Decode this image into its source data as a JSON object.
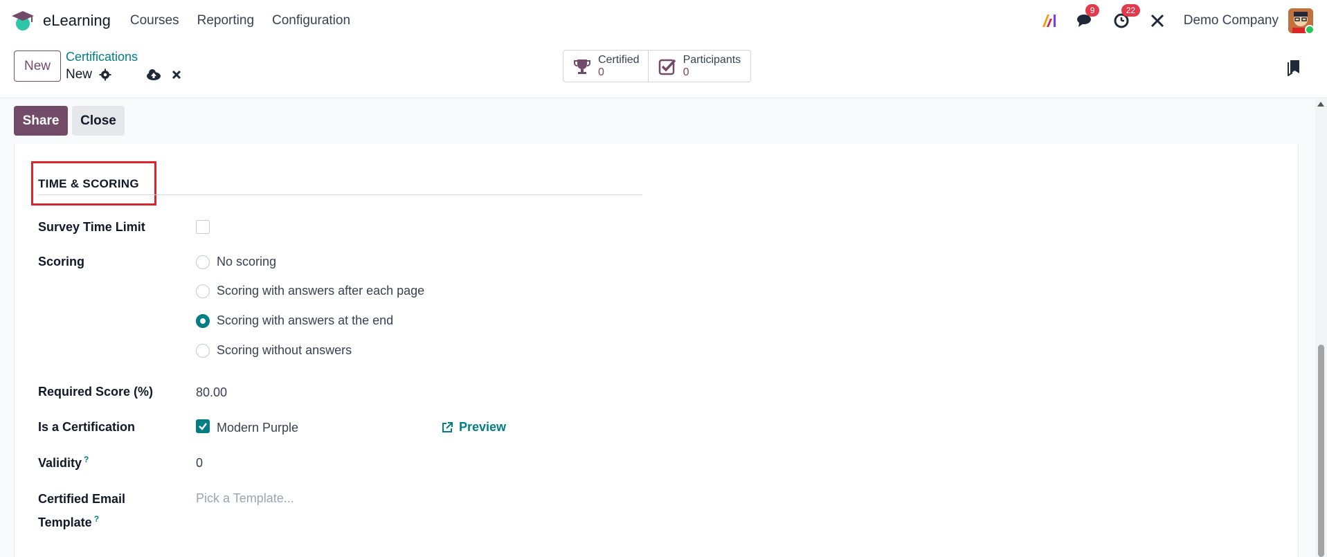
{
  "app": {
    "name": "eLearning",
    "menu": [
      "Courses",
      "Reporting",
      "Configuration"
    ],
    "company": "Demo Company",
    "badges": {
      "messages": "9",
      "activities": "22"
    }
  },
  "control_panel": {
    "new_label": "New",
    "breadcrumb_parent": "Certifications",
    "breadcrumb_current": "New",
    "stats": [
      {
        "label": "Certified",
        "value": "0"
      },
      {
        "label": "Participants",
        "value": "0"
      }
    ]
  },
  "status_bar": {
    "share_label": "Share",
    "close_label": "Close"
  },
  "form": {
    "section_title": "TIME & SCORING",
    "survey_time_limit": {
      "label": "Survey Time Limit",
      "checked": false
    },
    "scoring": {
      "label": "Scoring",
      "options": [
        {
          "label": "No scoring",
          "checked": false
        },
        {
          "label": "Scoring with answers after each page",
          "checked": false
        },
        {
          "label": "Scoring with answers at the end",
          "checked": true
        },
        {
          "label": "Scoring without answers",
          "checked": false
        }
      ]
    },
    "required_score": {
      "label": "Required Score (%)",
      "value": "80.00"
    },
    "is_certification": {
      "label": "Is a Certification",
      "checked": true,
      "layout_value": "Modern Purple",
      "preview_label": "Preview"
    },
    "validity": {
      "label": "Validity",
      "help": "?",
      "value": "0"
    },
    "certified_email_template": {
      "label_line1": "Certified Email",
      "label_line2": "Template",
      "help": "?",
      "placeholder": "Pick a Template..."
    }
  },
  "colors": {
    "primary": "#714b67",
    "accent": "#017e84",
    "highlight": "#d9232d",
    "badge": "#e03a4c"
  },
  "icons": [
    "graduation-cap-icon",
    "ai-icon",
    "chat-icon",
    "clock-icon",
    "tools-icon",
    "gear-icon",
    "cloud-upload-icon",
    "discard-icon",
    "trophy-icon",
    "check-square-icon",
    "bookmark-icon",
    "external-link-icon"
  ]
}
